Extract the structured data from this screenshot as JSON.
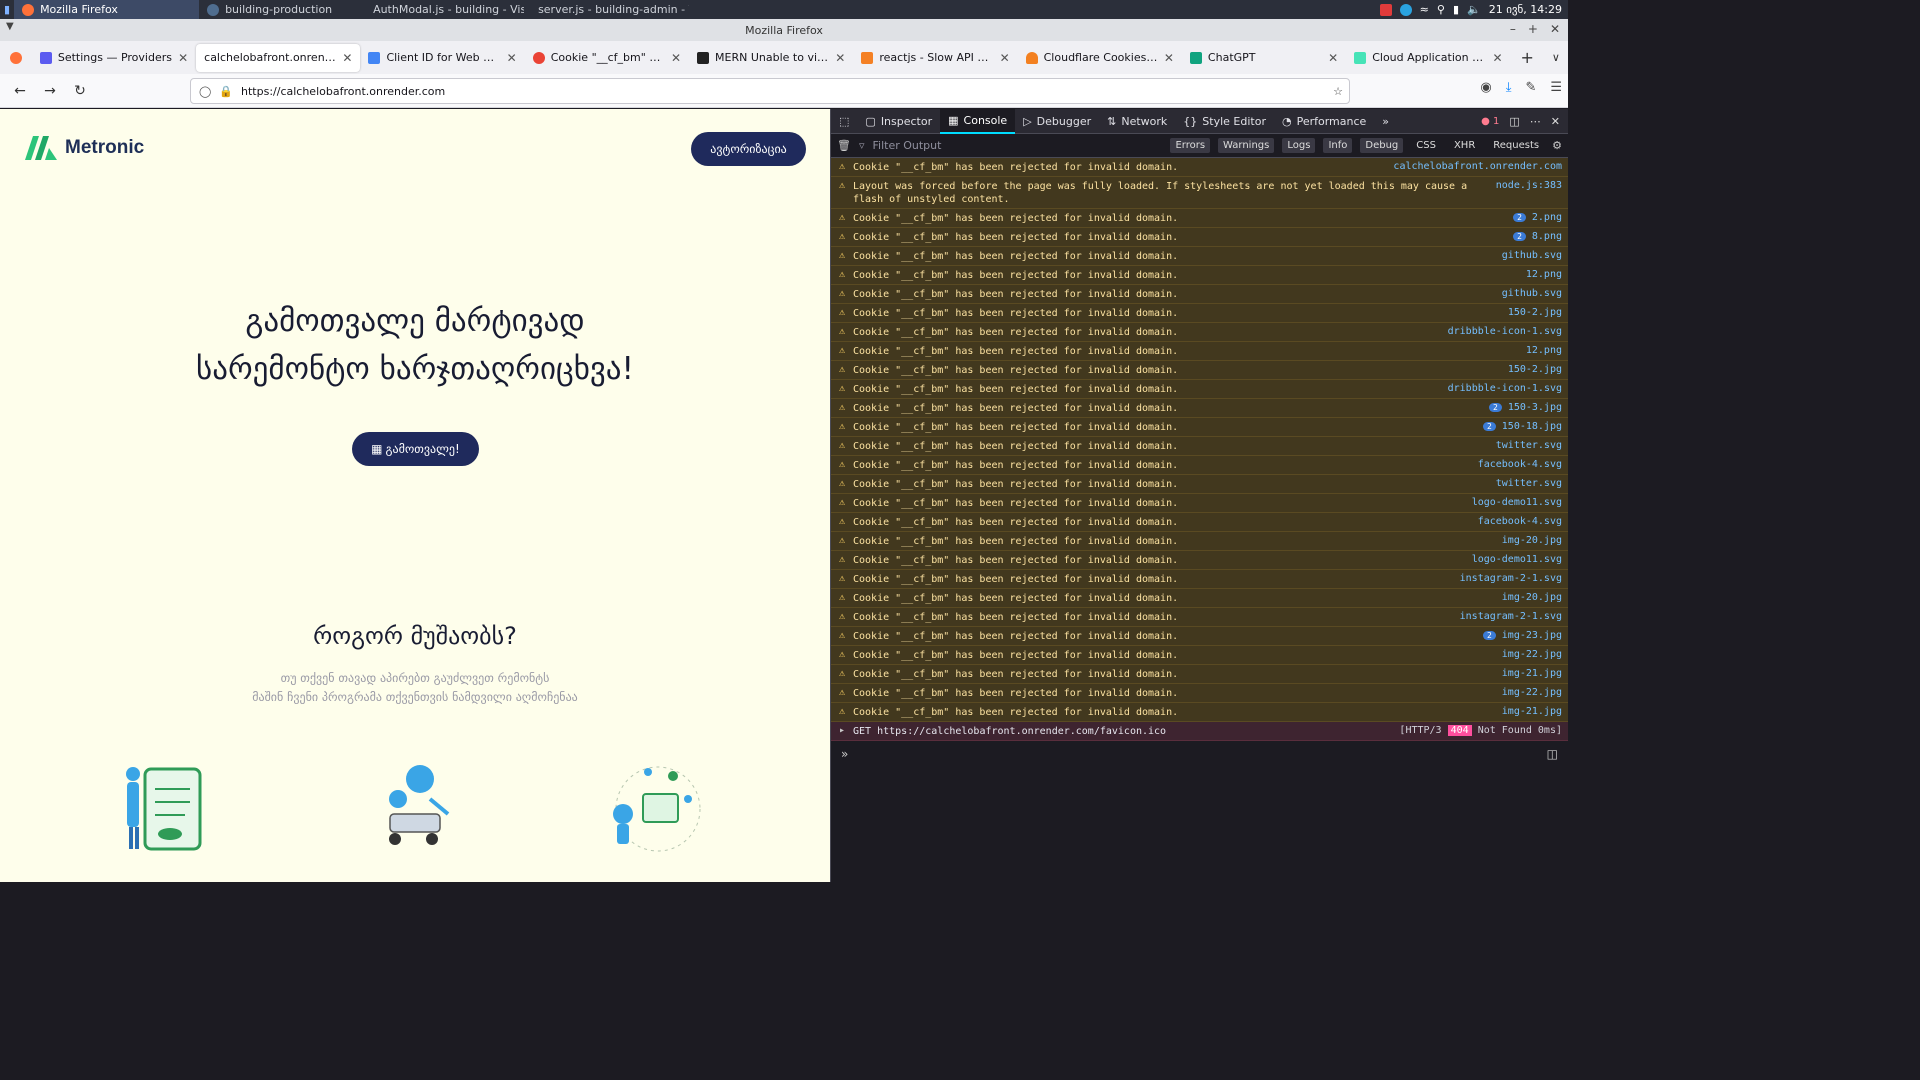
{
  "taskbar": {
    "items": [
      {
        "label": "Mozilla Firefox",
        "active": true
      },
      {
        "label": "building-production",
        "active": false
      },
      {
        "label": "AuthModal.js - building - Vis...",
        "active": false
      },
      {
        "label": "server.js - building-admin - V...",
        "active": false
      }
    ],
    "clock": "21 ივნ, 14:29"
  },
  "window": {
    "title": "Mozilla Firefox"
  },
  "tabs": [
    {
      "label": "Settings — Providers",
      "active": false,
      "color": "#5b5bf0"
    },
    {
      "label": "calchelobafront.onrender.com",
      "active": true,
      "color": ""
    },
    {
      "label": "Client ID for Web applica",
      "active": false,
      "color": "#4285f4"
    },
    {
      "label": "Cookie \"__cf_bm\" has bee",
      "active": false,
      "color": "#ea4335"
    },
    {
      "label": "MERN Unable to view ph",
      "active": false,
      "color": "#222222"
    },
    {
      "label": "reactjs - Slow API Calls an",
      "active": false,
      "color": "#f48024"
    },
    {
      "label": "Cloudflare Cookies · Clou",
      "active": false,
      "color": "#f38020"
    },
    {
      "label": "ChatGPT",
      "active": false,
      "color": "#10a37f"
    },
    {
      "label": "Cloud Application Hostin",
      "active": false,
      "color": "#46e3b7"
    }
  ],
  "nav": {
    "url": "https://calchelobafront.onrender.com"
  },
  "site": {
    "brand": "Metronic",
    "auth_button": "ავტორიზაცია",
    "hero_line1": "გამოთვალე მარტივად",
    "hero_line2": "სარემონტო ხარჯთაღრიცხვა!",
    "calc_button": "გამოთვალე!",
    "how_title": "როგორ მუშაობს?",
    "how_sub1": "თუ თქვენ თავად აპირებთ გაუძლვეთ რემონტს",
    "how_sub2": "მაშინ ჩვენი პროგრამა თქვენთვის ნამდვილი აღმოჩენაა"
  },
  "devtools": {
    "tabs": [
      "Inspector",
      "Console",
      "Debugger",
      "Network",
      "Style Editor",
      "Performance"
    ],
    "active_tab": "Console",
    "error_count": "1",
    "filter_placeholder": "Filter Output",
    "filter_buttons": [
      "Errors",
      "Warnings",
      "Logs",
      "Info",
      "Debug"
    ],
    "filter_extra": [
      "CSS",
      "XHR",
      "Requests"
    ],
    "messages": [
      {
        "text": "Cookie \"__cf_bm\" has been rejected for invalid domain.",
        "source": "calchelobafront.onrender.com",
        "count": ""
      },
      {
        "text": "Layout was forced before the page was fully loaded. If stylesheets are not yet loaded this may cause a flash of unstyled content.",
        "source": "node.js:383",
        "count": ""
      },
      {
        "text": "Cookie \"__cf_bm\" has been rejected for invalid domain.",
        "source": "2.png",
        "count": "2"
      },
      {
        "text": "Cookie \"__cf_bm\" has been rejected for invalid domain.",
        "source": "8.png",
        "count": "2"
      },
      {
        "text": "Cookie \"__cf_bm\" has been rejected for invalid domain.",
        "source": "github.svg",
        "count": ""
      },
      {
        "text": "Cookie \"__cf_bm\" has been rejected for invalid domain.",
        "source": "12.png",
        "count": ""
      },
      {
        "text": "Cookie \"__cf_bm\" has been rejected for invalid domain.",
        "source": "github.svg",
        "count": ""
      },
      {
        "text": "Cookie \"__cf_bm\" has been rejected for invalid domain.",
        "source": "150-2.jpg",
        "count": ""
      },
      {
        "text": "Cookie \"__cf_bm\" has been rejected for invalid domain.",
        "source": "dribbble-icon-1.svg",
        "count": ""
      },
      {
        "text": "Cookie \"__cf_bm\" has been rejected for invalid domain.",
        "source": "12.png",
        "count": ""
      },
      {
        "text": "Cookie \"__cf_bm\" has been rejected for invalid domain.",
        "source": "150-2.jpg",
        "count": ""
      },
      {
        "text": "Cookie \"__cf_bm\" has been rejected for invalid domain.",
        "source": "dribbble-icon-1.svg",
        "count": ""
      },
      {
        "text": "Cookie \"__cf_bm\" has been rejected for invalid domain.",
        "source": "150-3.jpg",
        "count": "2"
      },
      {
        "text": "Cookie \"__cf_bm\" has been rejected for invalid domain.",
        "source": "150-18.jpg",
        "count": "2"
      },
      {
        "text": "Cookie \"__cf_bm\" has been rejected for invalid domain.",
        "source": "twitter.svg",
        "count": ""
      },
      {
        "text": "Cookie \"__cf_bm\" has been rejected for invalid domain.",
        "source": "facebook-4.svg",
        "count": ""
      },
      {
        "text": "Cookie \"__cf_bm\" has been rejected for invalid domain.",
        "source": "twitter.svg",
        "count": ""
      },
      {
        "text": "Cookie \"__cf_bm\" has been rejected for invalid domain.",
        "source": "logo-demo11.svg",
        "count": ""
      },
      {
        "text": "Cookie \"__cf_bm\" has been rejected for invalid domain.",
        "source": "facebook-4.svg",
        "count": ""
      },
      {
        "text": "Cookie \"__cf_bm\" has been rejected for invalid domain.",
        "source": "img-20.jpg",
        "count": ""
      },
      {
        "text": "Cookie \"__cf_bm\" has been rejected for invalid domain.",
        "source": "logo-demo11.svg",
        "count": ""
      },
      {
        "text": "Cookie \"__cf_bm\" has been rejected for invalid domain.",
        "source": "instagram-2-1.svg",
        "count": ""
      },
      {
        "text": "Cookie \"__cf_bm\" has been rejected for invalid domain.",
        "source": "img-20.jpg",
        "count": ""
      },
      {
        "text": "Cookie \"__cf_bm\" has been rejected for invalid domain.",
        "source": "instagram-2-1.svg",
        "count": ""
      },
      {
        "text": "Cookie \"__cf_bm\" has been rejected for invalid domain.",
        "source": "img-23.jpg",
        "count": "2"
      },
      {
        "text": "Cookie \"__cf_bm\" has been rejected for invalid domain.",
        "source": "img-22.jpg",
        "count": ""
      },
      {
        "text": "Cookie \"__cf_bm\" has been rejected for invalid domain.",
        "source": "img-21.jpg",
        "count": ""
      },
      {
        "text": "Cookie \"__cf_bm\" has been rejected for invalid domain.",
        "source": "img-22.jpg",
        "count": ""
      },
      {
        "text": "Cookie \"__cf_bm\" has been rejected for invalid domain.",
        "source": "img-21.jpg",
        "count": ""
      }
    ],
    "request": {
      "method": "GET",
      "url": "https://calchelobafront.onrender.com/favicon.ico",
      "protocol": "[HTTP/3",
      "status": "404",
      "status_text": "Not Found 0ms]"
    }
  }
}
